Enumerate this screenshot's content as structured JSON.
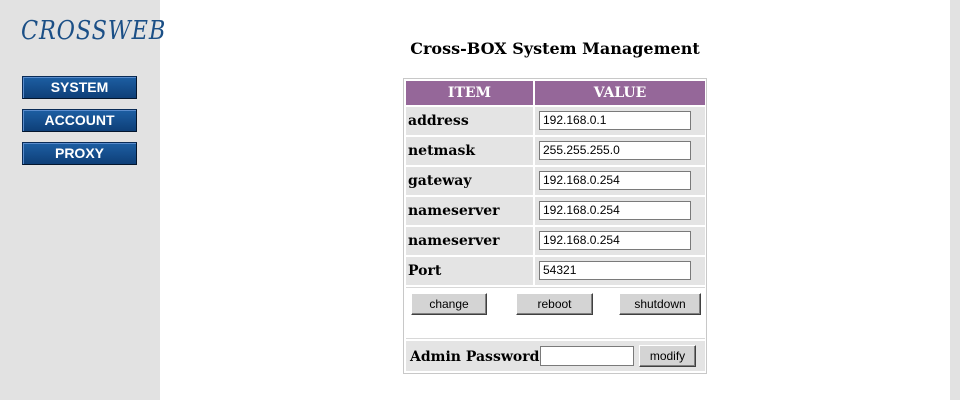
{
  "sidebar": {
    "logo": "CROSSWEB",
    "nav": [
      "SYSTEM",
      "ACCOUNT",
      "PROXY"
    ]
  },
  "main": {
    "title": "Cross-BOX System Management",
    "table": {
      "headers": [
        "ITEM",
        "VALUE"
      ],
      "rows": [
        {
          "item": "address",
          "value": "192.168.0.1"
        },
        {
          "item": "netmask",
          "value": "255.255.255.0"
        },
        {
          "item": "gateway",
          "value": "192.168.0.254"
        },
        {
          "item": "nameserver",
          "value": "192.168.0.254"
        },
        {
          "item": "nameserver",
          "value": "192.168.0.254"
        },
        {
          "item": "Port",
          "value": "54321"
        }
      ]
    },
    "buttons": {
      "change": "change",
      "reboot": "reboot",
      "shutdown": "shutdown"
    },
    "admin": {
      "label": "Admin Password",
      "value": "",
      "modify": "modify"
    }
  },
  "colors": {
    "header_bg": "#956799",
    "nav_bg": "#0e3f78",
    "sidebar_bg": "#e2e2e2",
    "cell_bg": "#e4e4e4"
  }
}
